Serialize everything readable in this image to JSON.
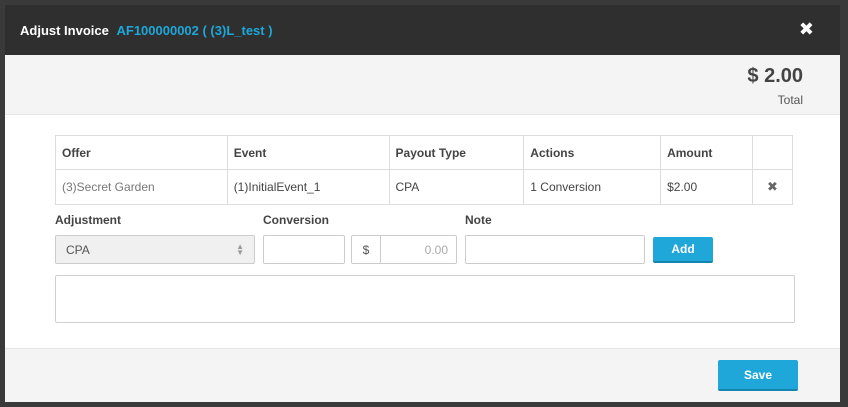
{
  "header": {
    "title": "Adjust Invoice",
    "invoice_ref": "AF100000002 ( (3)L_test )",
    "close_glyph": "✖"
  },
  "summary": {
    "total_amount": "$ 2.00",
    "total_label": "Total"
  },
  "table": {
    "headers": [
      "Offer",
      "Event",
      "Payout Type",
      "Actions",
      "Amount",
      ""
    ],
    "rows": [
      {
        "offer": "(3)Secret Garden",
        "event": "(1)InitialEvent_1",
        "payout_type": "CPA",
        "actions": "1 Conversion",
        "amount": "$2.00",
        "remove_glyph": "✖"
      }
    ]
  },
  "adjust_form": {
    "adjustment_label": "Adjustment",
    "adjustment_value": "CPA",
    "conversion_label": "Conversion",
    "conversion_value": "",
    "currency_symbol": "$",
    "amount_placeholder": "0.00",
    "note_label": "Note",
    "note_value": "",
    "add_label": "Add"
  },
  "footer": {
    "save_label": "Save"
  },
  "colors": {
    "accent": "#1ea7d8",
    "header_bg": "#2f2f2f"
  }
}
